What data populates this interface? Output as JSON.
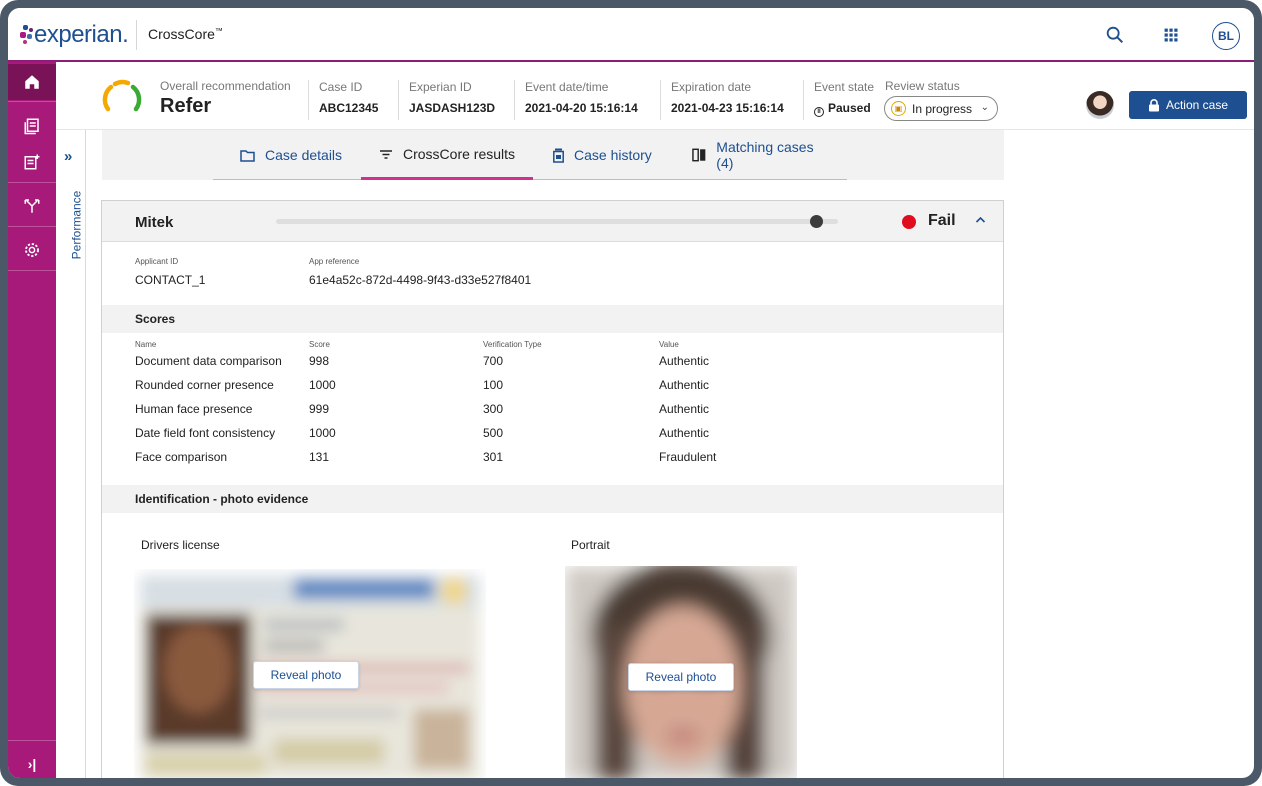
{
  "brand": {
    "logo_text": "experian.",
    "product": "CrossCore",
    "product_mark": "™",
    "accent": "#a71a7a",
    "primary": "#1d4f91"
  },
  "topbar": {
    "user_initials": "BL",
    "icons": [
      "search-icon",
      "apps-grid-icon"
    ]
  },
  "nav": {
    "items": [
      "home-icon",
      "cases-icon",
      "add-case-icon",
      "workflow-icon",
      "settings-icon"
    ],
    "expand_icon": "›|"
  },
  "performance": {
    "label": "Performance",
    "chevron": "»"
  },
  "case": {
    "recommendation_label": "Overall recommendation",
    "recommendation_value": "Refer",
    "case_id_label": "Case ID",
    "case_id": "ABC12345",
    "experian_id_label": "Experian ID",
    "experian_id": "JASDASH123D",
    "event_datetime_label": "Event date/time",
    "event_datetime": "2021-04-20 15:16:14",
    "expiration_label": "Expiration date",
    "expiration": "2021-04-23 15:16:14",
    "event_state_label": "Event state",
    "event_state": "Paused",
    "review_status_label": "Review status",
    "review_status": "In progress",
    "action_label": "Action case"
  },
  "tabs": [
    {
      "label": "Case details",
      "icon": "folder-icon"
    },
    {
      "label": "CrossCore results",
      "icon": "filter-icon"
    },
    {
      "label": "Case history",
      "icon": "history-icon"
    },
    {
      "label": "Matching cases (4)",
      "icon": "matching-icon"
    }
  ],
  "panel": {
    "title": "Mitek",
    "result": "Fail",
    "result_color": "#e00d1f",
    "applicant_id_label": "Applicant ID",
    "applicant_id": "CONTACT_1",
    "app_ref_label": "App reference",
    "app_ref": "61e4a52c-872d-4498-9f43-d33e527f8401",
    "scores_title": "Scores",
    "score_headers": [
      "Name",
      "Score",
      "Verification Type",
      "Value"
    ],
    "scores": [
      [
        "Document data comparison",
        "998",
        "700",
        "Authentic"
      ],
      [
        "Rounded corner presence",
        "1000",
        "100",
        "Authentic"
      ],
      [
        "Human face presence",
        "999",
        "300",
        "Authentic"
      ],
      [
        "Date field font consistency",
        "1000",
        "500",
        "Authentic"
      ],
      [
        "Face comparison",
        "131",
        "301",
        "Fraudulent"
      ]
    ],
    "evidence_title": "Identification - photo evidence",
    "photo_labels": [
      "Drivers license",
      "Portrait"
    ],
    "reveal_label": "Reveal photo"
  }
}
